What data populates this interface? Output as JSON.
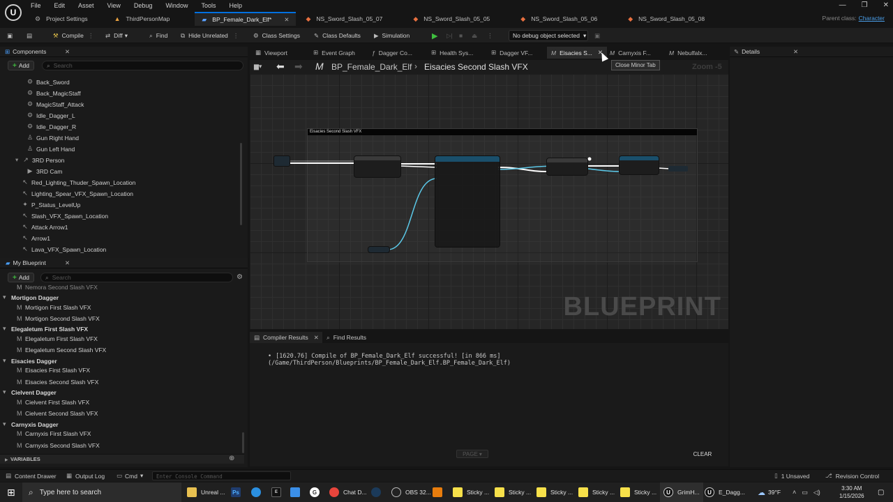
{
  "menu": [
    "File",
    "Edit",
    "Asset",
    "View",
    "Debug",
    "Window",
    "Tools",
    "Help"
  ],
  "doc_tabs": [
    {
      "label": "Project Settings",
      "icon": "gear-icon",
      "active": false
    },
    {
      "label": "ThirdPersonMap",
      "icon": "map-icon",
      "active": false
    },
    {
      "label": "BP_Female_Dark_Elf*",
      "icon": "blueprint-icon",
      "active": true
    },
    {
      "label": "NS_Sword_Slash_05_07",
      "icon": "niagara-icon",
      "active": false
    },
    {
      "label": "NS_Sword_Slash_05_05",
      "icon": "niagara-icon",
      "active": false
    },
    {
      "label": "NS_Sword_Slash_05_06",
      "icon": "niagara-icon",
      "active": false
    },
    {
      "label": "NS_Sword_Slash_05_08",
      "icon": "niagara-icon",
      "active": false
    }
  ],
  "parent_class": {
    "label": "Parent class:",
    "value": "Character"
  },
  "toolbar": {
    "compile": "Compile",
    "diff": "Diff",
    "find": "Find",
    "hide_unrelated": "Hide Unrelated",
    "class_settings": "Class Settings",
    "class_defaults": "Class Defaults",
    "simulation": "Simulation",
    "debug_object": "No debug object selected"
  },
  "components": {
    "title": "Components",
    "add": "Add",
    "search_placeholder": "Search",
    "items": [
      {
        "label": "Back_Sword",
        "icon": "socket-icon"
      },
      {
        "label": "Back_MagicStaff",
        "icon": "socket-icon"
      },
      {
        "label": "MagicStaff_Attack",
        "icon": "socket-icon"
      },
      {
        "label": "Idle_Dagger_L",
        "icon": "socket-icon"
      },
      {
        "label": "Idle_Dagger_R",
        "icon": "socket-icon"
      },
      {
        "label": "Gun Right Hand",
        "icon": "person-icon"
      },
      {
        "label": "Gun Left Hand",
        "icon": "person-icon"
      },
      {
        "label": "3RD Person",
        "icon": "spring-arm-icon"
      },
      {
        "label": "3RD Cam",
        "icon": "camera-icon"
      },
      {
        "label": "Red_Lighting_Thuder_Spawn_Location",
        "icon": "arrow-icon"
      },
      {
        "label": "Lighting_Spear_VFX_Spawn_Location",
        "icon": "arrow-icon"
      },
      {
        "label": "P_Status_LevelUp",
        "icon": "particle-icon"
      },
      {
        "label": "Slash_VFX_Spawn_Location",
        "icon": "arrow-icon"
      },
      {
        "label": "Attack Arrow1",
        "icon": "arrow-icon"
      },
      {
        "label": "Arrow1",
        "icon": "arrow-icon"
      },
      {
        "label": "Lava_VFX_Spawn_Location",
        "icon": "arrow-icon"
      }
    ]
  },
  "my_blueprint": {
    "title": "My Blueprint",
    "add": "Add",
    "search_placeholder": "Search",
    "variables": "VARIABLES",
    "items": [
      {
        "label": "Nemora Second Slash VFX",
        "cat": false
      },
      {
        "label": "Mortigon Dagger",
        "cat": true
      },
      {
        "label": "Mortigon First Slash VFX",
        "cat": false
      },
      {
        "label": "Mortigon Second Slash VFX",
        "cat": false
      },
      {
        "label": "Elegaletum First Slash VFX",
        "cat": true
      },
      {
        "label": "Elegaletum First Slash VFX",
        "cat": false
      },
      {
        "label": "Elegaletum Second Slash VFX",
        "cat": false
      },
      {
        "label": "Eisacies Dagger",
        "cat": true
      },
      {
        "label": "Eisacies First Slash VFX",
        "cat": false
      },
      {
        "label": "Eisacies Second Slash VFX",
        "cat": false
      },
      {
        "label": "Cielvent Dagger",
        "cat": true
      },
      {
        "label": "Cielvent First Slash VFX",
        "cat": false
      },
      {
        "label": "Cielvent Second Slash VFX",
        "cat": false
      },
      {
        "label": "Carnyxis Dagger",
        "cat": true
      },
      {
        "label": "Carnyxis First Slash VFX",
        "cat": false
      },
      {
        "label": "Carnyxis Second Slash VFX",
        "cat": false
      }
    ]
  },
  "graph_tabs": [
    {
      "label": "Viewport",
      "glyph": "▦"
    },
    {
      "label": "Event Graph",
      "glyph": "⊞"
    },
    {
      "label": "Dagger Co...",
      "glyph": "ƒ"
    },
    {
      "label": "Health Sys...",
      "glyph": "⊞"
    },
    {
      "label": "Dagger VF...",
      "glyph": "⊞"
    },
    {
      "label": "Eisacies S...",
      "glyph": "M"
    },
    {
      "label": "Carnyxis F...",
      "glyph": "M"
    },
    {
      "label": "Nebulfalx...",
      "glyph": "M"
    }
  ],
  "details": {
    "title": "Details"
  },
  "tooltip": "Close Minor Tab",
  "breadcrumb": {
    "root": "BP_Female_Dark_Elf",
    "sep": "›",
    "current": "Eisacies Second Slash VFX",
    "zoom": "Zoom -5"
  },
  "graph": {
    "comment": "Eisacies Second Slash VFX",
    "watermark": "BLUEPRINT"
  },
  "compiler": {
    "tab": "Compiler Results",
    "find_tab": "Find Results",
    "message": "[1620.76] Compile of BP_Female_Dark_Elf successful! [in 866 ms] (/Game/ThirdPerson/Blueprints/BP_Female_Dark_Elf.BP_Female_Dark_Elf)",
    "page": "PAGE",
    "clear": "CLEAR"
  },
  "status": {
    "content_drawer": "Content Drawer",
    "output_log": "Output Log",
    "cmd": "Cmd",
    "console_placeholder": "Enter Console Command",
    "unsaved": "1 Unsaved",
    "revision": "Revision Control"
  },
  "taskbar": {
    "search": "Type here to search",
    "apps": [
      "Unreal ...",
      "Chat D...",
      "OBS 32...",
      "Sticky ...",
      "Sticky ...",
      "Sticky ...",
      "Sticky ...",
      "Sticky ...",
      "GrimH...",
      "E_Dagg..."
    ],
    "weather": "39°F",
    "time": "3:30 AM",
    "date": "1/15/2026"
  }
}
